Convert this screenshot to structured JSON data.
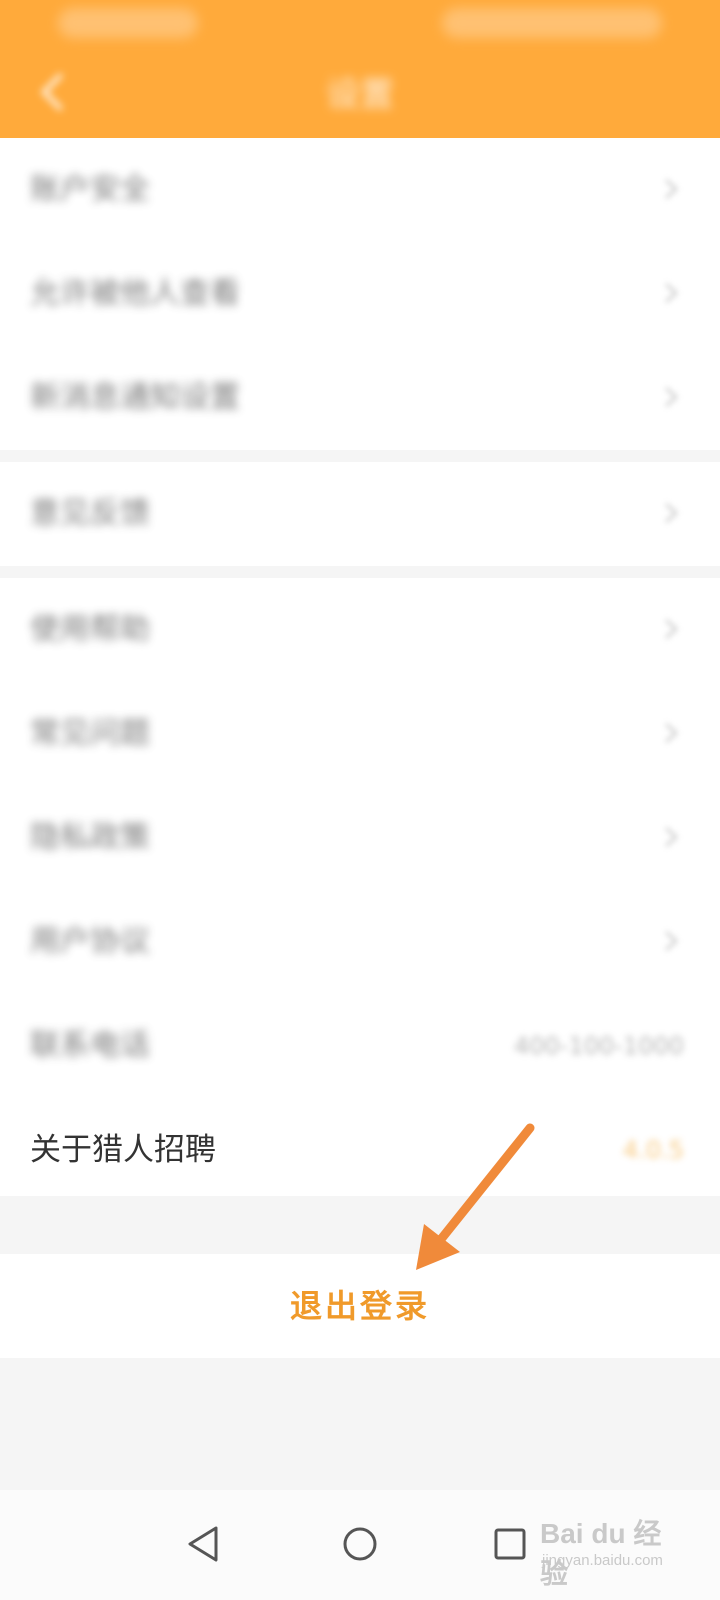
{
  "statusbar": {
    "left_text": "",
    "right_text": ""
  },
  "header": {
    "title": "设置",
    "back_icon": "chevron-left-icon"
  },
  "settings": {
    "group1": [
      {
        "label": "账户安全"
      },
      {
        "label": "允许被他人查看"
      },
      {
        "label": "新消息通知设置"
      }
    ],
    "group2": [
      {
        "label": "意见反馈"
      }
    ],
    "group3": [
      {
        "label": "使用帮助"
      },
      {
        "label": "常见问题"
      },
      {
        "label": "隐私政策"
      },
      {
        "label": "用户协议"
      },
      {
        "label": "联系电话",
        "value": "400-100-1000"
      },
      {
        "label": "关于猎人招聘",
        "value": "4.0.5"
      }
    ]
  },
  "logout": {
    "label": "退出登录"
  },
  "annotation": {
    "arrow_color": "#f08a3a"
  },
  "navbar": {
    "back": "triangle-back-icon",
    "home": "circle-home-icon",
    "recents": "square-recents-icon"
  },
  "watermark": {
    "brand": "Bai du 经验",
    "url": "jingyan.baidu.com"
  },
  "colors": {
    "header": "#ffaa3b",
    "accent": "#f09a2a",
    "background": "#f5f5f5"
  }
}
